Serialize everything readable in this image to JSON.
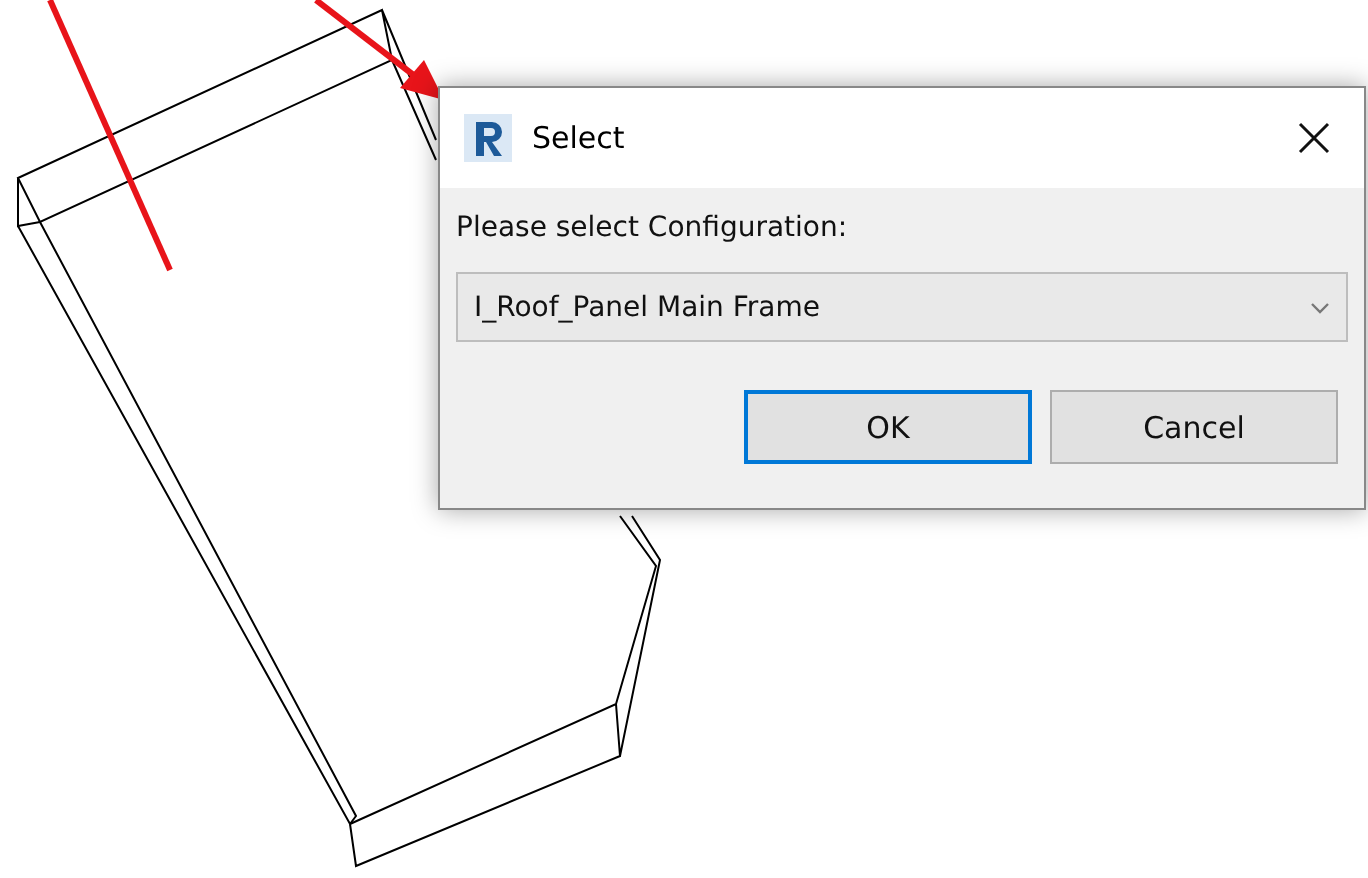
{
  "dialog": {
    "title": "Select",
    "prompt": "Please select Configuration:",
    "configuration": {
      "value": "I_Roof_Panel Main Frame"
    },
    "buttons": [
      {
        "label": "OK",
        "default": true
      },
      {
        "label": "Cancel",
        "default": false
      }
    ]
  }
}
